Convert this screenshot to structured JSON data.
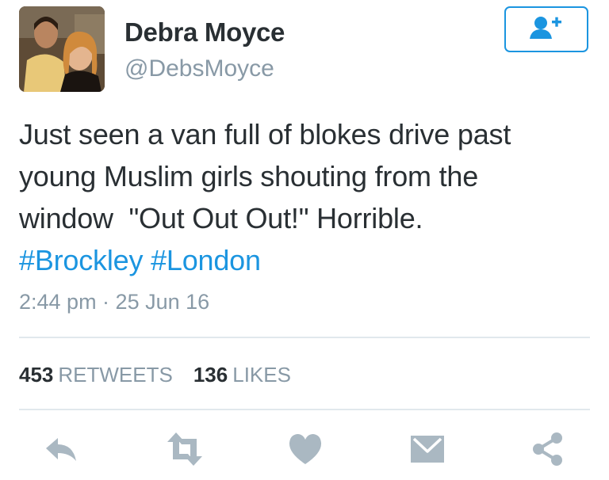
{
  "user": {
    "name": "Debra Moyce",
    "handle": "@DebsMoyce"
  },
  "follow_button": {
    "icon": "add-user-icon"
  },
  "tweet": {
    "lines": [
      "Just seen a van full of blokes drive past",
      "young Muslim girls shouting from the",
      "window  \"Out Out Out!\" Horrible."
    ],
    "hashtags": [
      "#Brockley",
      "#London"
    ],
    "timestamp": "2:44 pm · 25 Jun 16"
  },
  "stats": {
    "retweets_count": "453",
    "retweets_label": "RETWEETS",
    "likes_count": "136",
    "likes_label": "LIKES"
  },
  "actions": [
    "reply-icon",
    "retweet-icon",
    "like-icon",
    "direct-message-icon",
    "share-icon"
  ],
  "colors": {
    "accent": "#1b95e0",
    "text": "#292f33",
    "muted": "#8899a6",
    "icon": "#aab8c2",
    "divider": "#e1e8ed"
  }
}
